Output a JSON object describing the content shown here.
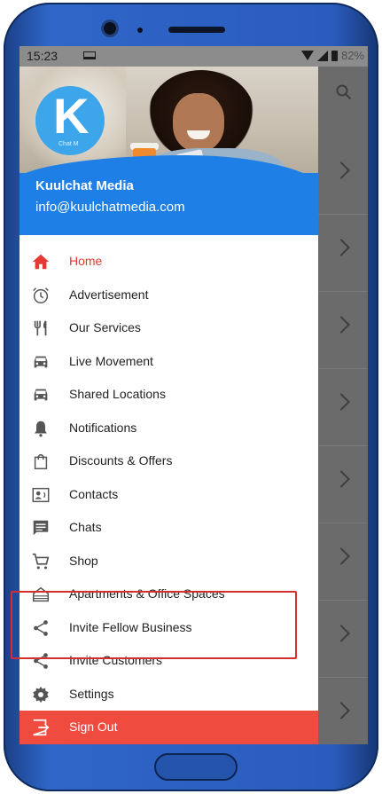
{
  "status_bar": {
    "time": "15:23",
    "battery": "82%"
  },
  "header": {
    "logo_letter": "K",
    "logo_caption": "Chat M",
    "name": "Kuulchat Media",
    "email": "info@kuulchatmedia.com"
  },
  "menu": {
    "items": [
      {
        "label": "Home",
        "icon": "home-icon"
      },
      {
        "label": "Advertisement",
        "icon": "alarm-clock-icon"
      },
      {
        "label": "Our Services",
        "icon": "fork-knife-icon"
      },
      {
        "label": "Live Movement",
        "icon": "car-icon"
      },
      {
        "label": "Shared Locations",
        "icon": "car-icon"
      },
      {
        "label": "Notifications",
        "icon": "bell-icon"
      },
      {
        "label": "Discounts & Offers",
        "icon": "shopping-bag-icon"
      },
      {
        "label": "Contacts",
        "icon": "contact-card-icon"
      },
      {
        "label": "Chats",
        "icon": "chat-bubble-icon"
      },
      {
        "label": "Shop",
        "icon": "cart-icon"
      },
      {
        "label": "Apartments & Office Spaces",
        "icon": "building-icon"
      },
      {
        "label": "Invite Fellow Business",
        "icon": "share-icon"
      },
      {
        "label": "Invite Customers",
        "icon": "share-icon"
      },
      {
        "label": "Settings",
        "icon": "gear-icon"
      },
      {
        "label": "Sign Out",
        "icon": "logout-icon"
      }
    ]
  },
  "colors": {
    "brand_blue": "#1e7fe6",
    "active_red": "#e53935",
    "signout_red": "#ef4b3f",
    "highlight_red": "#d32f2f"
  }
}
